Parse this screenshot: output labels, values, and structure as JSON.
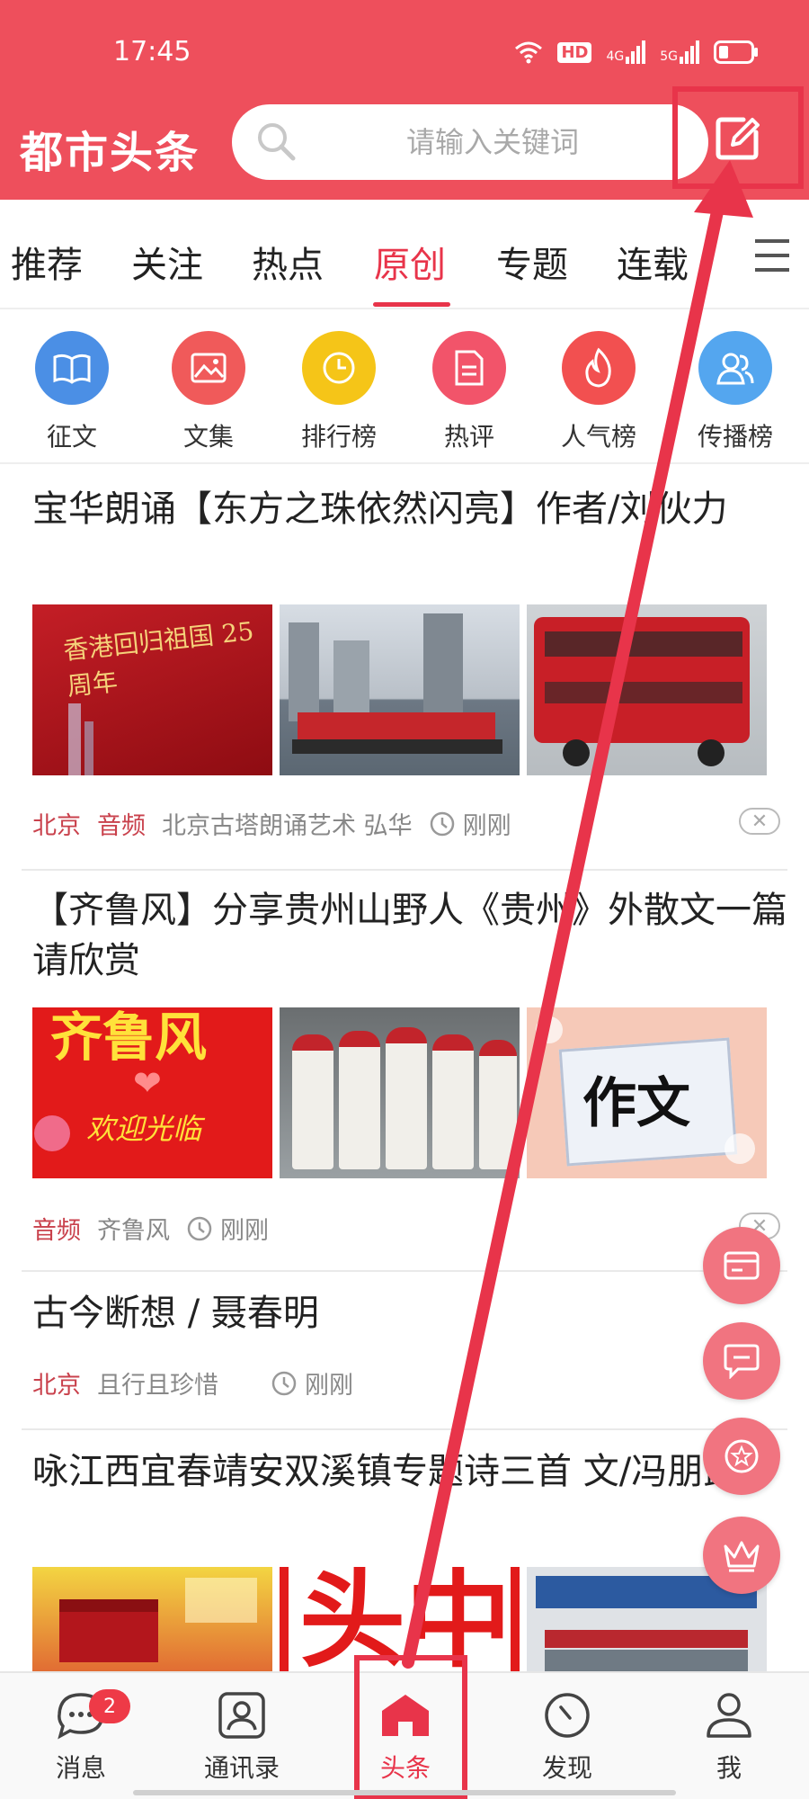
{
  "status_bar": {
    "time": "17:45",
    "net_hd": "HD",
    "net_4g": "4G",
    "net_5g": "5G"
  },
  "header": {
    "title": "都市头条",
    "search_placeholder": "请输入关键词"
  },
  "tabs": [
    {
      "label": "推荐"
    },
    {
      "label": "关注"
    },
    {
      "label": "热点"
    },
    {
      "label": "原创"
    },
    {
      "label": "专题"
    },
    {
      "label": "连载"
    }
  ],
  "quick_links": [
    {
      "label": "征文",
      "color": "#4b8fe5"
    },
    {
      "label": "文集",
      "color": "#f05a5a"
    },
    {
      "label": "排行榜",
      "color": "#f5c518"
    },
    {
      "label": "热评",
      "color": "#f2546a"
    },
    {
      "label": "人气榜",
      "color": "#f25050"
    },
    {
      "label": "传播榜",
      "color": "#54a6ef"
    }
  ],
  "articles": [
    {
      "title": "宝华朗诵【东方之珠依然闪亮】作者/刘伙力",
      "tags": [
        "北京",
        "音频"
      ],
      "author": "北京古塔朗诵艺术 弘华",
      "time": "刚刚",
      "img1_text": "香港回归祖国 25周年"
    },
    {
      "title": "【齐鲁风】分享贵州山野人《贵州》外散文一篇请欣赏",
      "tags": [
        "音频"
      ],
      "author": "齐鲁风",
      "time": "刚刚",
      "img1_text": "齐鲁风",
      "img1_sub": "欢迎光临",
      "img3_text": "作文"
    },
    {
      "title": "古今断想 / 聂春明",
      "tags": [
        "北京"
      ],
      "author": "且行且珍惜",
      "time": "刚刚"
    },
    {
      "title": "咏江西宜春靖安双溪镇专题诗三首 文/冯朋武",
      "img2_text": "头中"
    }
  ],
  "bottom_nav": [
    {
      "label": "消息",
      "badge": "2"
    },
    {
      "label": "通讯录"
    },
    {
      "label": "头条"
    },
    {
      "label": "发现"
    },
    {
      "label": "我"
    }
  ],
  "colors": {
    "brand": "#ee4f5c",
    "accent": "#e8344a",
    "tag": "#c9414c"
  }
}
